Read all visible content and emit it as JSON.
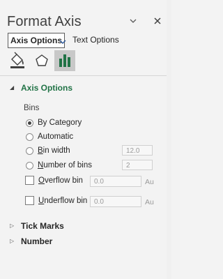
{
  "header": {
    "title": "Format Axis"
  },
  "sub_tabs": {
    "active": "Axis Options",
    "other": "Text Options"
  },
  "icons": {
    "pin": "pin-dropdown-icon",
    "close": "close-icon",
    "fill": "fill-line-icon",
    "effects": "effects-pentagon-icon",
    "axis_options": "axis-options-bars-icon"
  },
  "axis_options": {
    "title": "Axis Options",
    "bins_label": "Bins",
    "radios": [
      {
        "pre": "",
        "u": "",
        "label": "By Category",
        "checked": true
      },
      {
        "pre": "",
        "u": "",
        "label": "Automatic",
        "checked": false
      },
      {
        "pre": "",
        "u": "B",
        "label": "in width",
        "checked": false
      },
      {
        "pre": "",
        "u": "N",
        "label": "umber of bins",
        "checked": false
      }
    ],
    "bin_width_value": "12.0",
    "number_of_bins_value": "2",
    "overflow": {
      "u": "O",
      "label": "verflow bin",
      "value": "0.0",
      "unit": "Au"
    },
    "underflow": {
      "u": "U",
      "label": "nderflow bin",
      "value": "0.0",
      "unit": "Au"
    }
  },
  "sections": {
    "tick_marks": "Tick Marks",
    "number": "Number"
  },
  "colors": {
    "accent": "#217346",
    "background": "#f3f3f3"
  }
}
